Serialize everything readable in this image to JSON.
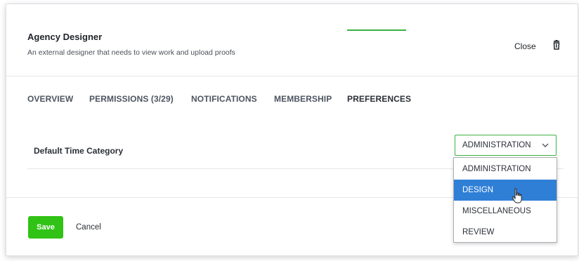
{
  "header": {
    "title": "Agency Designer",
    "subtitle": "An external designer that needs to view work and upload proofs",
    "close_label": "Close",
    "trash_icon": "trash-icon"
  },
  "tabs": [
    {
      "label": "OVERVIEW",
      "active": false
    },
    {
      "label": "PERMISSIONS (3/29)",
      "active": false
    },
    {
      "label": "NOTIFICATIONS",
      "active": false
    },
    {
      "label": "MEMBERSHIP",
      "active": false
    },
    {
      "label": "PREFERENCES",
      "active": true
    }
  ],
  "preferences": {
    "default_time_category_label": "Default Time Category",
    "default_time_category_value": "ADMINISTRATION"
  },
  "dropdown": {
    "options": [
      "ADMINISTRATION",
      "DESIGN",
      "MISCELLANEOUS",
      "REVIEW"
    ],
    "highlighted": "DESIGN"
  },
  "footer": {
    "save_label": "Save",
    "cancel_label": "Cancel"
  },
  "colors": {
    "accent_green": "#31c216",
    "tab_underline": "#3cb043",
    "highlight_blue": "#2f7fd6"
  }
}
